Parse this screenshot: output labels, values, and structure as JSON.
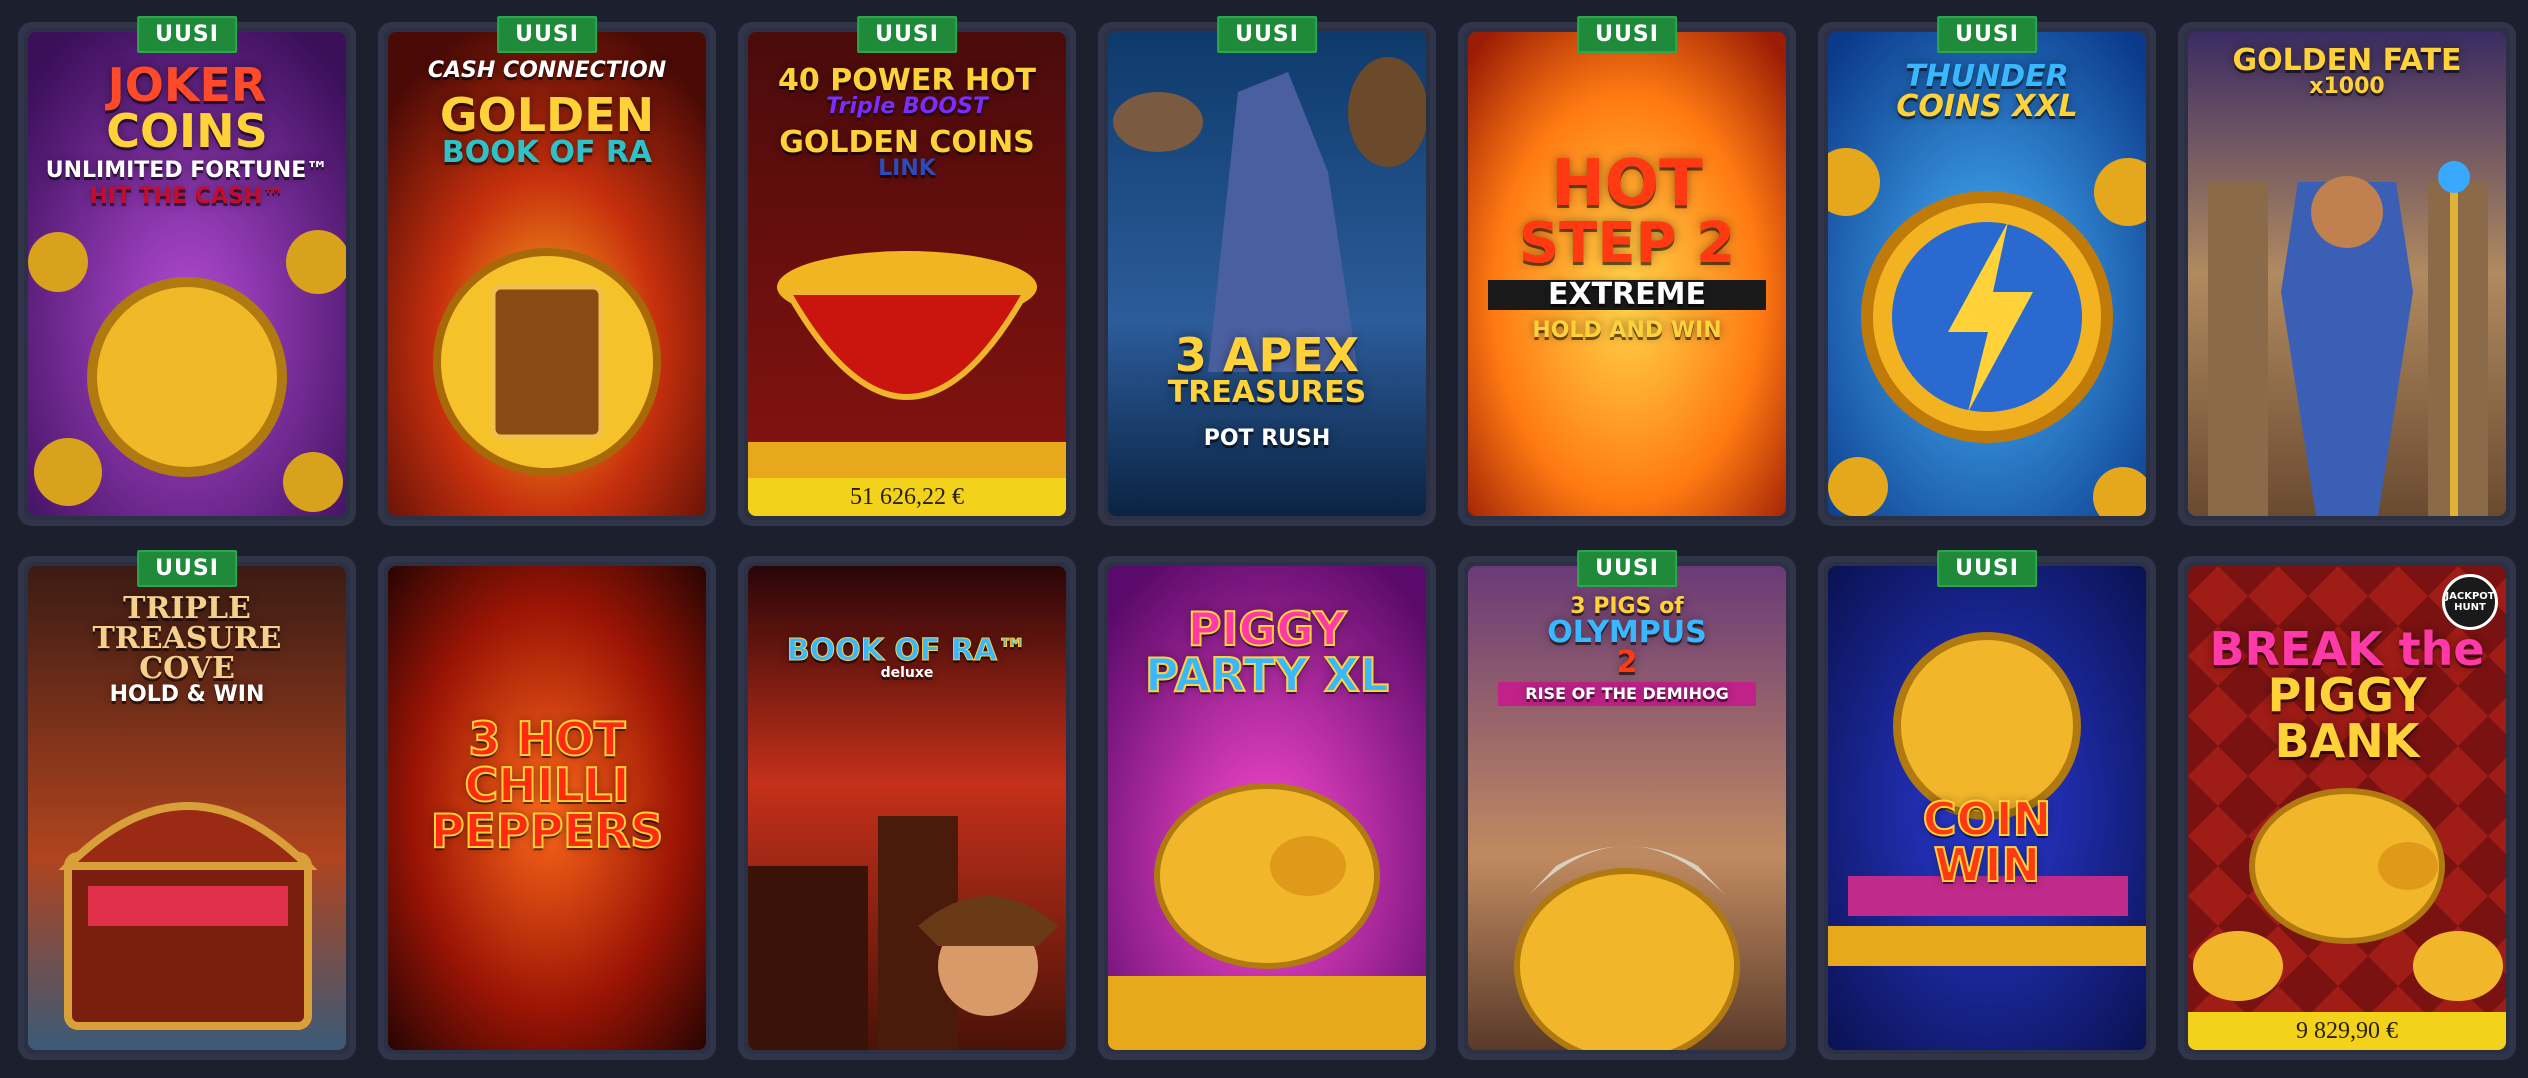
{
  "badge_label": "UUSI",
  "colors": {
    "background": "#1b1f2e",
    "card_frame": "#2b3044",
    "badge": "#1f8a3a",
    "jackpot_bar": "#f3d21b"
  },
  "games": [
    {
      "lines": [
        "JOKER",
        "COINS",
        "UNLIMITED FORTUNE™",
        "HIT THE CASH™"
      ],
      "new": true,
      "jackpot": null
    },
    {
      "lines": [
        "CASH CONNECTION",
        "GOLDEN",
        "BOOK OF RA"
      ],
      "new": true,
      "jackpot": null
    },
    {
      "lines": [
        "40 POWER HOT",
        "Triple BOOST",
        "GOLDEN COINS",
        "LINK"
      ],
      "new": true,
      "jackpot": "51 626,22 €"
    },
    {
      "lines": [
        "3 APEX",
        "TREASURES",
        "POT RUSH"
      ],
      "new": true,
      "jackpot": null
    },
    {
      "lines": [
        "HOT",
        "STEP 2",
        "EXTREME",
        "HOLD AND WIN"
      ],
      "new": true,
      "jackpot": null
    },
    {
      "lines": [
        "THUNDER",
        "COINS XXL"
      ],
      "new": true,
      "jackpot": null
    },
    {
      "lines": [
        "GOLDEN FATE",
        "x1000"
      ],
      "new": false,
      "jackpot": null
    },
    {
      "lines": [
        "TRIPLE",
        "TREASURE",
        "COVE",
        "HOLD & WIN"
      ],
      "new": true,
      "jackpot": null
    },
    {
      "lines": [
        "3 HOT",
        "CHILLI",
        "PEPPERS"
      ],
      "new": false,
      "jackpot": null
    },
    {
      "lines": [
        "BOOK OF RA™",
        "deluxe"
      ],
      "new": false,
      "jackpot": null
    },
    {
      "lines": [
        "PIGGY",
        "PARTY XL"
      ],
      "new": false,
      "jackpot": null
    },
    {
      "lines": [
        "3 PIGS of",
        "OLYMPUS",
        "2",
        "RISE OF THE DEMIHOG"
      ],
      "new": true,
      "jackpot": null
    },
    {
      "lines": [
        "COIN",
        "WIN"
      ],
      "new": true,
      "jackpot": null
    },
    {
      "lines": [
        "JACKPOT HUNT",
        "BREAK the",
        "PIGGY BANK"
      ],
      "new": false,
      "jackpot": "9 829,90 €"
    }
  ]
}
